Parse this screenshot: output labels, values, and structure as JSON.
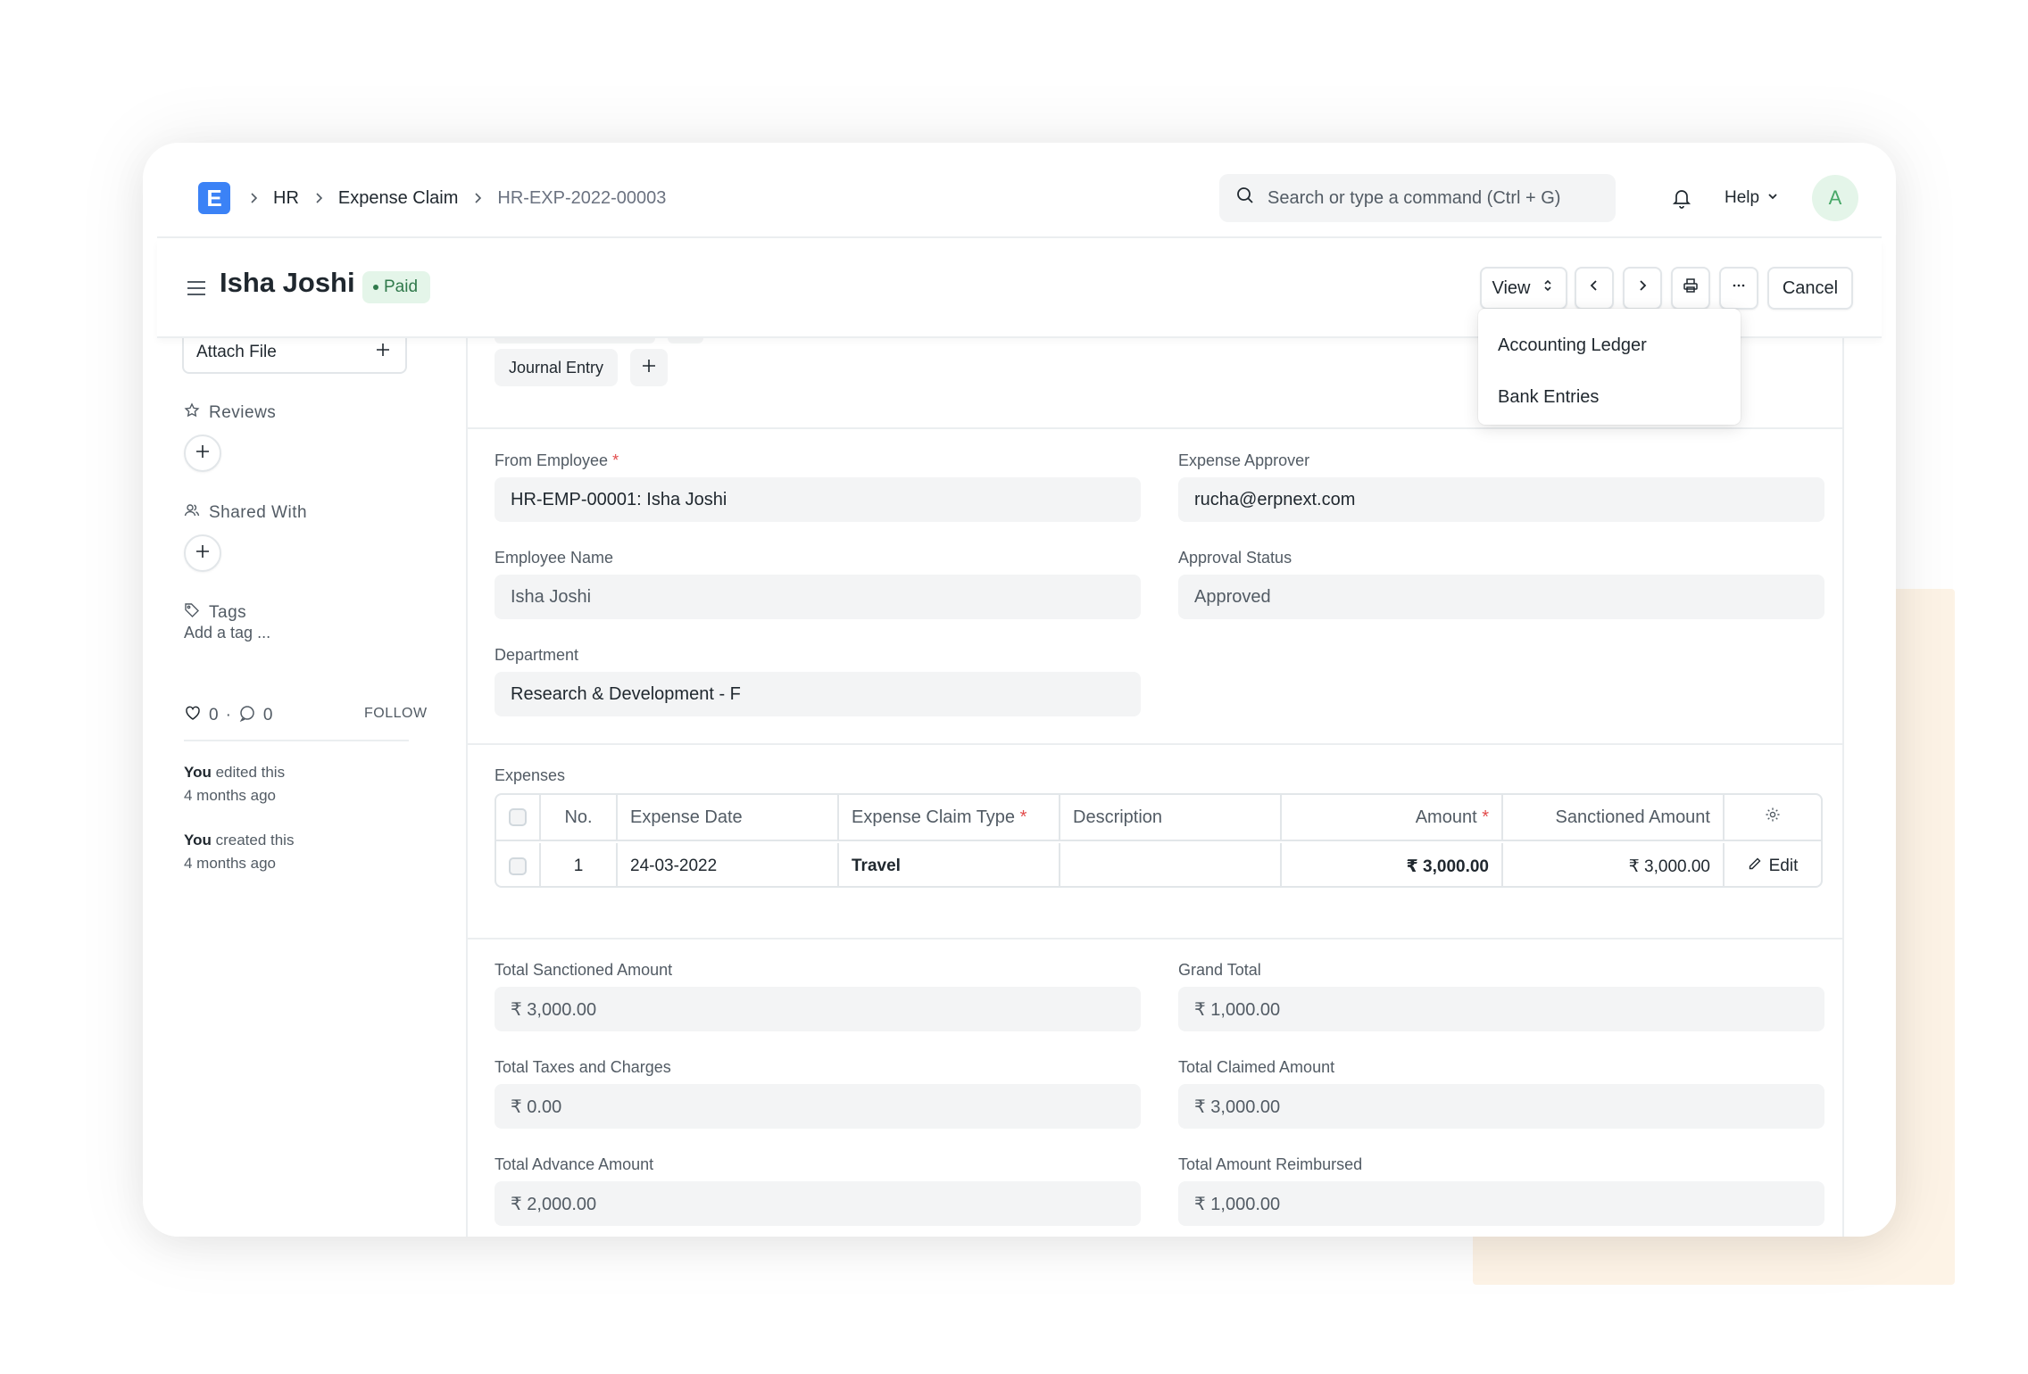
{
  "navbar": {
    "logo_letter": "E",
    "breadcrumbs": [
      "HR",
      "Expense Claim",
      "HR-EXP-2022-00003"
    ],
    "search_placeholder": "Search or type a command (Ctrl + G)",
    "help_label": "Help",
    "avatar_letter": "A"
  },
  "header": {
    "title": "Isha Joshi",
    "status": "Paid",
    "view_label": "View",
    "cancel_label": "Cancel"
  },
  "view_menu": {
    "items": [
      "Accounting Ledger",
      "Bank Entries"
    ]
  },
  "sidebar": {
    "attach_label": "Attach File",
    "reviews_label": "Reviews",
    "shared_label": "Shared With",
    "tags_label": "Tags",
    "add_tag": "Add a tag ...",
    "likes": "0",
    "comments": "0",
    "follow_label": "FOLLOW",
    "activity": [
      {
        "who": "You",
        "action": " edited this",
        "when": "4 months ago"
      },
      {
        "who": "You",
        "action": " created this",
        "when": "4 months ago"
      }
    ]
  },
  "connections": {
    "journal_entry_label": "Journal Entry"
  },
  "form": {
    "from_employee": {
      "label": "From Employee",
      "value": "HR-EMP-00001: Isha Joshi"
    },
    "expense_approver": {
      "label": "Expense Approver",
      "value": "rucha@erpnext.com"
    },
    "employee_name": {
      "label": "Employee Name",
      "value": "Isha Joshi"
    },
    "approval_status": {
      "label": "Approval Status",
      "value": "Approved"
    },
    "department": {
      "label": "Department",
      "value": "Research & Development - F"
    }
  },
  "expenses": {
    "section_label": "Expenses",
    "columns": [
      "No.",
      "Expense Date",
      "Expense Claim Type",
      "Description",
      "Amount",
      "Sanctioned Amount"
    ],
    "rows": [
      {
        "no": "1",
        "date": "24-03-2022",
        "type": "Travel",
        "description": "",
        "amount": "₹ 3,000.00",
        "sanctioned": "₹ 3,000.00",
        "edit_label": "Edit"
      }
    ]
  },
  "totals": {
    "total_sanctioned": {
      "label": "Total Sanctioned Amount",
      "value": "₹ 3,000.00"
    },
    "grand_total": {
      "label": "Grand Total",
      "value": "₹ 1,000.00"
    },
    "total_taxes": {
      "label": "Total Taxes and Charges",
      "value": "₹ 0.00"
    },
    "total_claimed": {
      "label": "Total Claimed Amount",
      "value": "₹ 3,000.00"
    },
    "total_advance": {
      "label": "Total Advance Amount",
      "value": "₹ 2,000.00"
    },
    "total_reimbursed": {
      "label": "Total Amount Reimbursed",
      "value": "₹ 1,000.00"
    }
  },
  "colors": {
    "brand": "#3b82f6",
    "paid_badge_bg": "#e4f5e9",
    "paid_badge_text": "#30794b",
    "required_marker": "#e24c4c"
  }
}
